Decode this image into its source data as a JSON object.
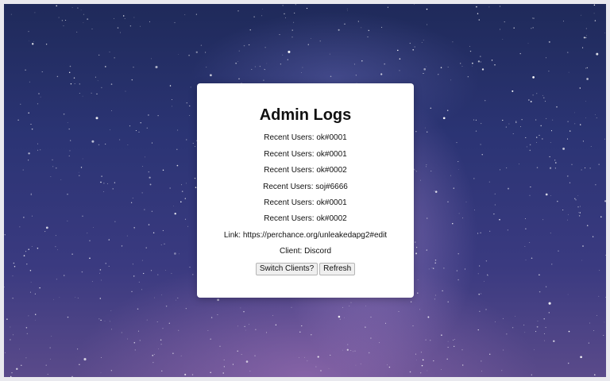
{
  "panel": {
    "title": "Admin Logs",
    "recent_users": [
      "Recent Users: ok#0001",
      "Recent Users: ok#0001",
      "Recent Users: ok#0002",
      "Recent Users: soj#6666",
      "Recent Users: ok#0001",
      "Recent Users: ok#0002"
    ],
    "link": "Link: https://perchance.org/unleakedapg2#edit",
    "client": "Client: Discord",
    "buttons": {
      "switch_clients": "Switch Clients?",
      "refresh": "Refresh"
    }
  },
  "background": {
    "description_icon": "starry-night-sky",
    "colors": [
      "#1f2a5a",
      "#2b3474",
      "#5a4a8a"
    ]
  }
}
